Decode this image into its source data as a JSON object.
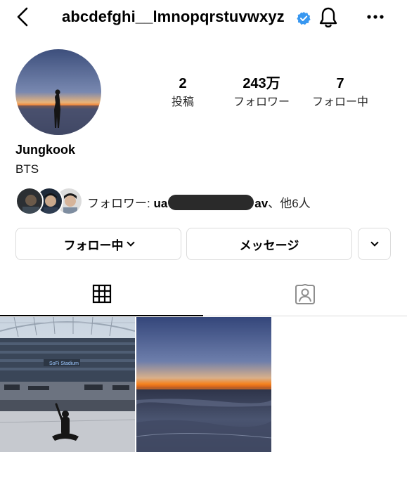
{
  "header": {
    "username": "abcdefghi__lmnopqrstuvwxyz",
    "verified_color": "#3897f0"
  },
  "profile": {
    "stats": [
      {
        "value": "2",
        "label": "投稿"
      },
      {
        "value": "243万",
        "label": "フォロワー"
      },
      {
        "value": "7",
        "label": "フォロー中"
      }
    ],
    "display_name": "Jungkook",
    "bio": "BTS"
  },
  "mutuals": {
    "prefix": "フォロワー: ",
    "name_start": "ua",
    "name_end": "av",
    "suffix": "、他6人"
  },
  "buttons": {
    "following": "フォロー中",
    "message": "メッセージ"
  },
  "tabs": [
    {
      "icon": "grid-icon",
      "active": true
    },
    {
      "icon": "tagged-person-icon",
      "active": false
    }
  ],
  "posts": [
    {
      "description_icon": "stadium-photo"
    },
    {
      "description_icon": "sunset-beach-photo"
    }
  ]
}
